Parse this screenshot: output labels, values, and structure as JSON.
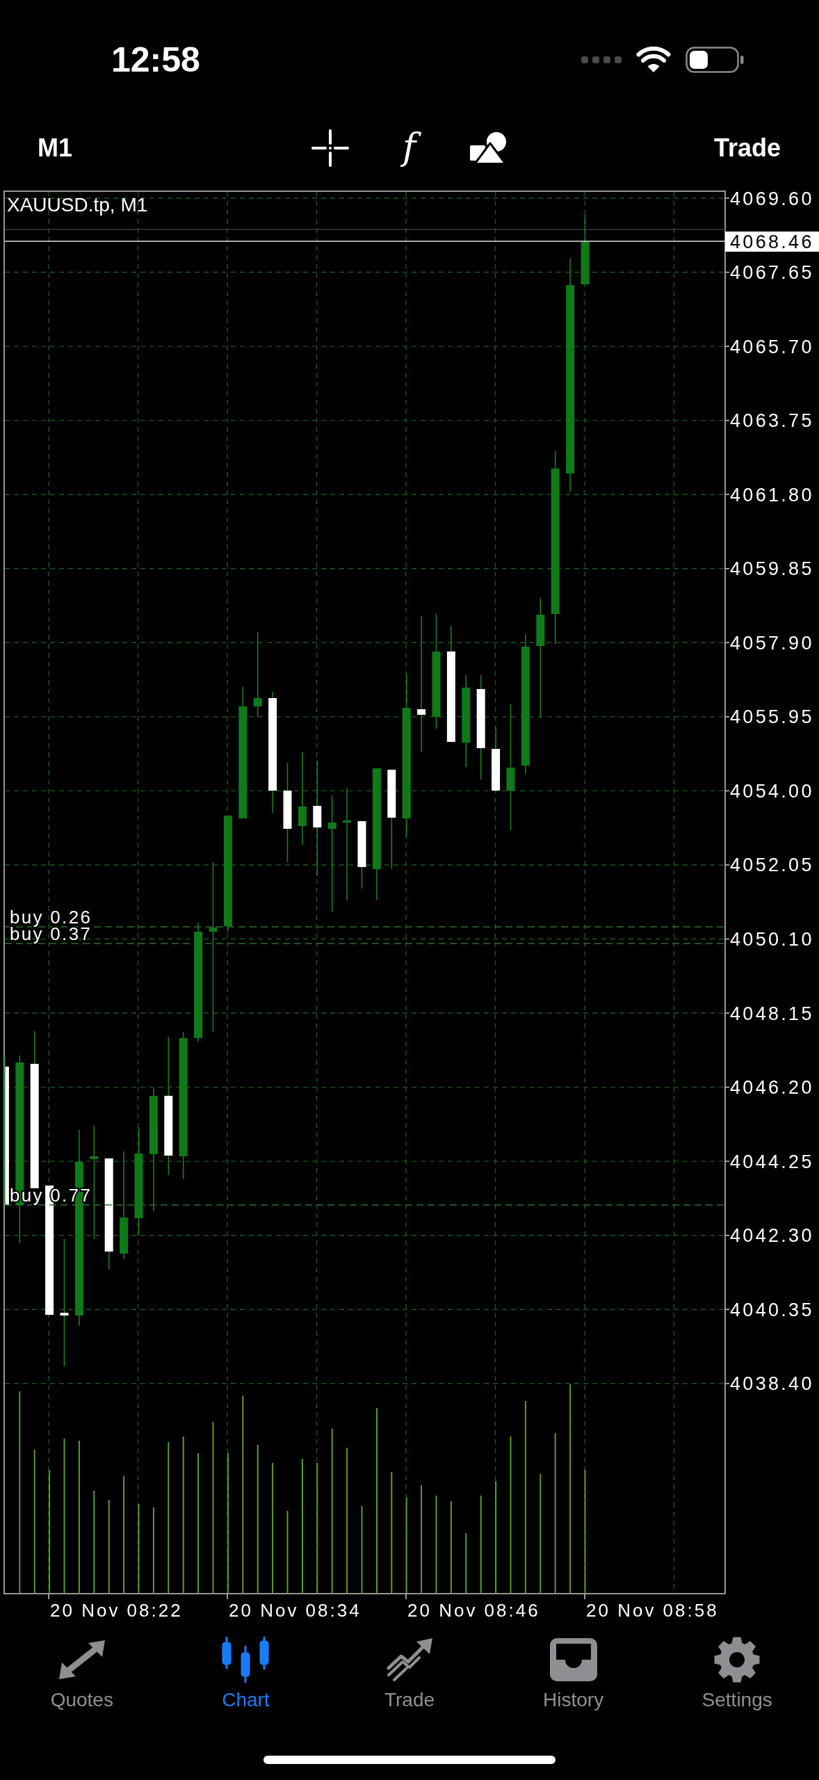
{
  "status_bar": {
    "time": "12:58"
  },
  "toolbar": {
    "timeframe": "M1",
    "indicator_glyph": "f",
    "trade_button": "Trade"
  },
  "chart": {
    "title": "XAUUSD.tp, M1",
    "price_labels": [
      "4069.60",
      "4067.65",
      "4065.70",
      "4063.75",
      "4061.80",
      "4059.85",
      "4057.90",
      "4055.95",
      "4054.00",
      "4052.05",
      "4050.10",
      "4048.15",
      "4046.20",
      "4044.25",
      "4042.30",
      "4040.35",
      "4038.40"
    ],
    "bid_label": "4068.46",
    "order_lines": [
      {
        "label": "buy 0.26"
      },
      {
        "label": "buy 0.37"
      },
      {
        "label": "buy 0.77"
      }
    ],
    "time_labels": [
      "20 Nov 08:22",
      "20 Nov 08:34",
      "20 Nov 08:46",
      "20 Nov 08:58"
    ]
  },
  "tab_bar": {
    "tabs": [
      {
        "label": "Quotes",
        "selected": false
      },
      {
        "label": "Chart",
        "selected": true
      },
      {
        "label": "Trade",
        "selected": false
      },
      {
        "label": "History",
        "selected": false
      },
      {
        "label": "Settings",
        "selected": false
      }
    ]
  }
}
